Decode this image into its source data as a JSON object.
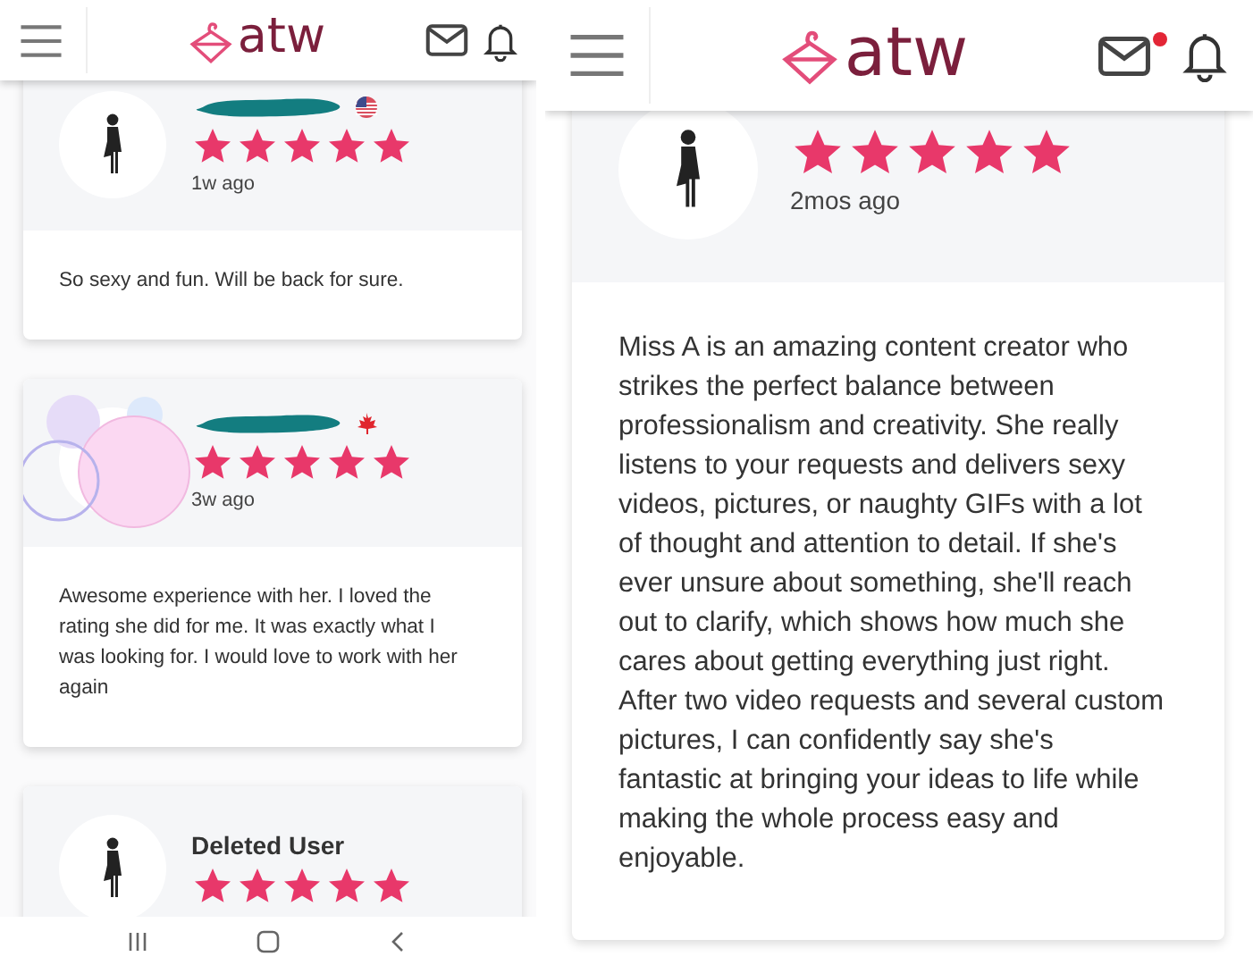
{
  "panels": [
    {
      "header": {
        "logo": "atw",
        "unread": false
      },
      "reviews": [
        {
          "name_redacted": true,
          "flag": {
            "kind": "us"
          },
          "stars": 5,
          "time": "1w ago",
          "text": "So sexy and fun. Will be back for sure."
        },
        {
          "bubbles": true,
          "name_redacted": true,
          "flag": {
            "kind": "ca"
          },
          "stars": 5,
          "time": "3w ago",
          "text": "Awesome experience with her. I loved the rating she did for me. It was exactly what I was looking for. I would love to work with her again"
        },
        {
          "name": "Deleted User",
          "stars": 5
        }
      ],
      "nav_bar": true
    },
    {
      "header": {
        "logo": "atw",
        "unread": true
      },
      "reviews": [
        {
          "stars": 5,
          "time": "2mos ago",
          "text": "Miss A is an amazing content creator who strikes the perfect balance between professionalism and creativity. She really listens to your requests and delivers sexy videos, pictures, or naughty GIFs with a lot of thought and attention to detail. If she's ever unsure about something, she'll reach out to clarify, which shows how much she cares about getting everything just right. After two video requests and several custom pictures, I can confidently say she's fantastic at bringing your ideas to life while making the whole process easy and enjoyable."
        }
      ]
    }
  ]
}
